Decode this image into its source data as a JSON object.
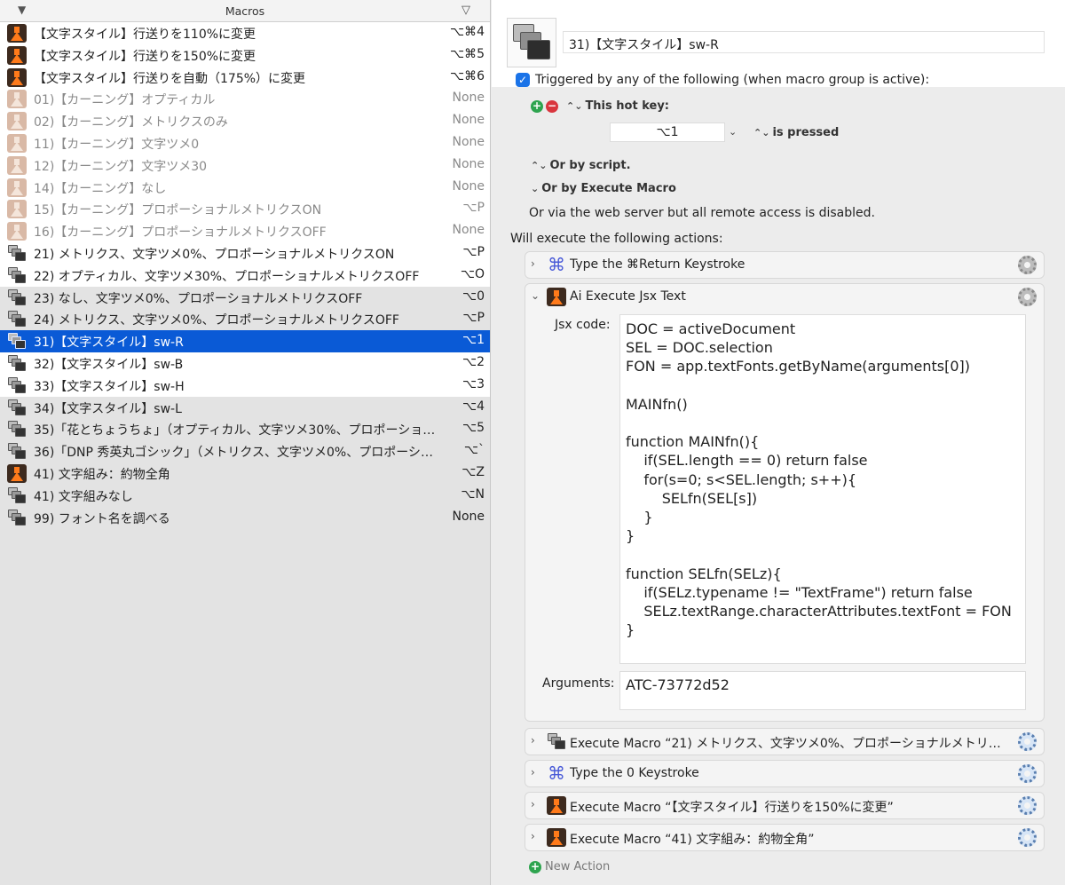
{
  "macros_panel": {
    "title": "Macros",
    "sort_icon": "triangle-down-icon",
    "filter_icon": "triangle-down-outline-icon",
    "items": [
      {
        "label": "【文字スタイル】行送りを110%に変更",
        "key": "⌥⌘4",
        "icon": "flask",
        "bg": "white",
        "dim": false
      },
      {
        "label": "【文字スタイル】行送りを150%に変更",
        "key": "⌥⌘5",
        "icon": "flask",
        "bg": "white",
        "dim": false
      },
      {
        "label": "【文字スタイル】行送りを自動（175%）に変更",
        "key": "⌥⌘6",
        "icon": "flask",
        "bg": "white",
        "dim": false
      },
      {
        "label": "01)【カーニング】オプティカル",
        "key": "None",
        "icon": "flask-dim",
        "bg": "white",
        "dim": true
      },
      {
        "label": "02)【カーニング】メトリクスのみ",
        "key": "None",
        "icon": "flask-dim",
        "bg": "white",
        "dim": true
      },
      {
        "label": "11)【カーニング】文字ツメ0",
        "key": "None",
        "icon": "flask-dim",
        "bg": "white",
        "dim": true
      },
      {
        "label": "12)【カーニング】文字ツメ30",
        "key": "None",
        "icon": "flask-dim",
        "bg": "white",
        "dim": true
      },
      {
        "label": "14)【カーニング】なし",
        "key": "None",
        "icon": "flask-dim",
        "bg": "white",
        "dim": true
      },
      {
        "label": "15)【カーニング】プロポーショナルメトリクスON",
        "key": "⌥P",
        "icon": "flask-dim",
        "bg": "white",
        "dim": true
      },
      {
        "label": "16)【カーニング】プロポーショナルメトリクスOFF",
        "key": "None",
        "icon": "flask-dim",
        "bg": "white",
        "dim": true
      },
      {
        "label": "21) メトリクス、文字ツメ0%、プロポーショナルメトリクスON",
        "key": "⌥P",
        "icon": "windows",
        "bg": "white",
        "dim": false
      },
      {
        "label": "22) オプティカル、文字ツメ30%、プロポーショナルメトリクスOFF",
        "key": "⌥O",
        "icon": "windows",
        "bg": "white",
        "dim": false
      },
      {
        "label": "23) なし、文字ツメ0%、プロポーショナルメトリクスOFF",
        "key": "⌥0",
        "icon": "windows",
        "bg": "grey",
        "dim": false
      },
      {
        "label": "24) メトリクス、文字ツメ0%、プロポーショナルメトリクスOFF",
        "key": "⌥P",
        "icon": "windows",
        "bg": "grey",
        "dim": false
      },
      {
        "label": "31)【文字スタイル】sw-R",
        "key": "⌥1",
        "icon": "windows",
        "bg": "sel",
        "dim": false
      },
      {
        "label": "32)【文字スタイル】sw-B",
        "key": "⌥2",
        "icon": "windows",
        "bg": "white",
        "dim": false
      },
      {
        "label": "33)【文字スタイル】sw-H",
        "key": "⌥3",
        "icon": "windows",
        "bg": "white",
        "dim": false
      },
      {
        "label": "34)【文字スタイル】sw-L",
        "key": "⌥4",
        "icon": "windows",
        "bg": "grey",
        "dim": false
      },
      {
        "label": "35)「花とちょうちょ」（オプティカル、文字ツメ30%、プロポーショナルメ…",
        "key": "⌥5",
        "icon": "windows",
        "bg": "grey",
        "dim": false
      },
      {
        "label": "36)「DNP 秀英丸ゴシック」（メトリクス、文字ツメ0%、プロポーショナル…",
        "key": "⌥`",
        "icon": "windows",
        "bg": "grey",
        "dim": false
      },
      {
        "label": "41) 文字組み：約物全角",
        "key": "⌥Z",
        "icon": "flask",
        "bg": "grey",
        "dim": false
      },
      {
        "label": "41) 文字組みなし",
        "key": "⌥N",
        "icon": "windows",
        "bg": "grey",
        "dim": false
      },
      {
        "label": "99) フォント名を調べる",
        "key": "None",
        "icon": "windows",
        "bg": "grey",
        "dim": false
      }
    ]
  },
  "editor": {
    "macro_name": "31)【文字スタイル】sw-R",
    "triggered_label": "Triggered by any of the following (when macro group is active):",
    "hotkey_label": "This hot key:",
    "hotkey_value": "⌥1",
    "is_pressed_label": "is pressed",
    "or_by_script": "Or by script.",
    "or_by_execute": "Or by Execute Macro",
    "via_web": "Or via the web server but all remote access is disabled.",
    "will_execute": "Will execute the following actions:",
    "jsx_label": "Jsx code:",
    "jsx_code": "DOC = activeDocument\nSEL = DOC.selection\nFON = app.textFonts.getByName(arguments[0])\n\nMAINfn()\n\nfunction MAINfn(){\n\tif(SEL.length == 0) return false\n\tfor(s=0; s<SEL.length; s++){\n\t\tSELfn(SEL[s])\n\t}\n}\n\nfunction SELfn(SELz){\n\tif(SELz.typename != \"TextFrame\") return false\n\tSELz.textRange.characterAttributes.textFont = FON\n}",
    "args_label": "Arguments:",
    "args_value": "ATC-73772d52",
    "new_action": "New Action",
    "actions": [
      {
        "title": "Type the ⌘Return Keystroke",
        "icon": "command-icon",
        "expanded": false
      },
      {
        "title": "Ai Execute Jsx Text",
        "icon": "flask-icon",
        "expanded": true
      },
      {
        "title": "Execute Macro “21) メトリクス、文字ツメ0%、プロポーショナルメトリクス…",
        "icon": "windows-icon",
        "expanded": false
      },
      {
        "title": "Type the 0 Keystroke",
        "icon": "command-icon",
        "expanded": false
      },
      {
        "title": "Execute Macro “【文字スタイル】行送りを150%に変更”",
        "icon": "flask-icon",
        "expanded": false
      },
      {
        "title": "Execute Macro “41) 文字組み：約物全角”",
        "icon": "flask-icon",
        "expanded": false
      }
    ]
  },
  "colors": {
    "selection": "#0a5ad6",
    "flask_orange": "#ff7a1a",
    "command_blue": "#4a5bd8"
  }
}
